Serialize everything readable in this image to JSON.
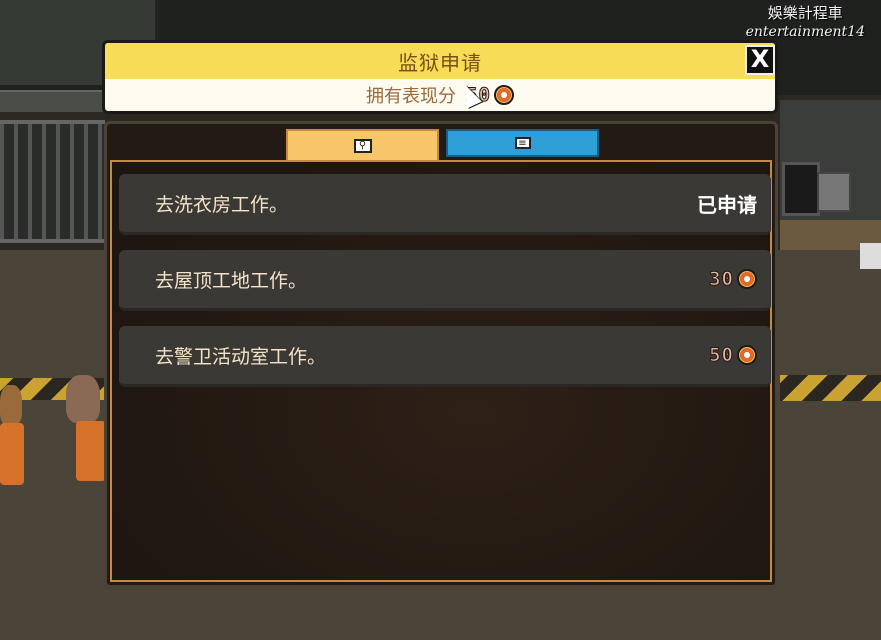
{
  "watermark": {
    "line1": "娛樂計程車",
    "line2": "entertainment14"
  },
  "header": {
    "title": "监狱申请",
    "subtitle": "拥有表现分",
    "points": "50",
    "points_icon": "reputation-badge-icon",
    "close_label": "X"
  },
  "tabs": [
    {
      "name": "search",
      "icon": "magnifier-icon",
      "active": true
    },
    {
      "name": "list",
      "icon": "list-icon",
      "active": false
    }
  ],
  "jobs": [
    {
      "label": "去洗衣房工作。",
      "status": "已申请",
      "cost": null
    },
    {
      "label": "去屋顶工地工作。",
      "status": null,
      "cost": "30"
    },
    {
      "label": "去警卫活动室工作。",
      "status": null,
      "cost": "50"
    }
  ],
  "colors": {
    "title_bar": "#f6dc57",
    "active_tab": "#f7c56a",
    "inactive_tab": "#2f9fd8",
    "row_bg": "#3b3935"
  }
}
